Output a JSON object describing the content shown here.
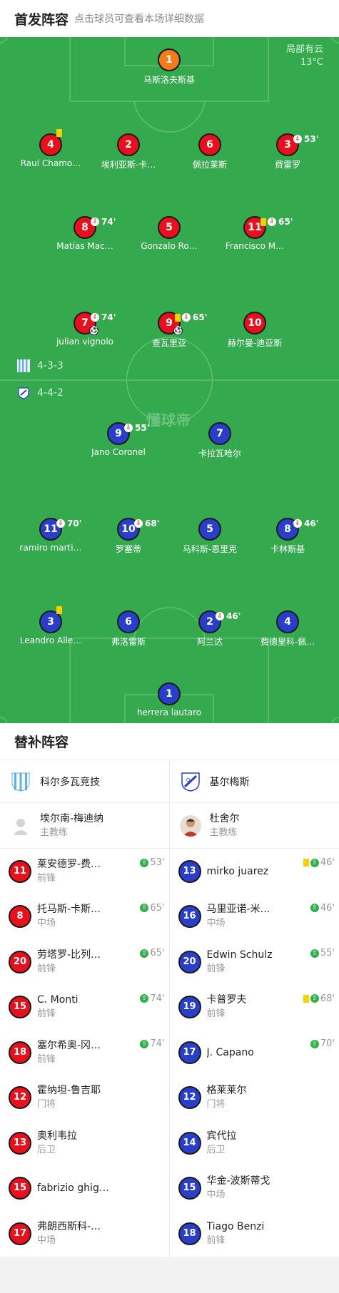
{
  "header": {
    "title": "首发阵容",
    "subtitle": "点击球员可查看本场详细数据"
  },
  "weather": {
    "condition": "局部有云",
    "temp": "13°C"
  },
  "watermark": "懂球帝",
  "formations": {
    "home": "4-3-3",
    "away": "4-4-2"
  },
  "home_players": [
    {
      "num": "1",
      "name": "马斯洛夫斯基",
      "color": "orange",
      "events": []
    },
    {
      "num": "4",
      "name": "Raul Chamo…",
      "color": "red",
      "yellow": true,
      "events": []
    },
    {
      "num": "2",
      "name": "埃利亚斯-卡…",
      "color": "red",
      "events": []
    },
    {
      "num": "6",
      "name": "佩拉莱斯",
      "color": "red",
      "events": []
    },
    {
      "num": "3",
      "name": "费雷罗",
      "color": "red",
      "sub_out": true,
      "sub_time": "53'"
    },
    {
      "num": "8",
      "name": "Matías Mac…",
      "color": "red",
      "sub_out": true,
      "sub_time": "74'"
    },
    {
      "num": "5",
      "name": "Gonzalo Ro…",
      "color": "red"
    },
    {
      "num": "11",
      "name": "Francisco M…",
      "color": "red",
      "yellow": true,
      "sub_out": true,
      "sub_time": "65'"
    },
    {
      "num": "7",
      "name": "julian vignolo",
      "color": "red",
      "sub_out": true,
      "sub_time": "74'",
      "goal": true
    },
    {
      "num": "9",
      "name": "查瓦里亚",
      "color": "red",
      "yellow": true,
      "sub_out": true,
      "sub_time": "65'",
      "goal": true
    },
    {
      "num": "10",
      "name": "赫尔曼-迪亚斯",
      "color": "red"
    }
  ],
  "away_players": [
    {
      "num": "9",
      "name": "Jano Coronel",
      "color": "blue",
      "sub_out": true,
      "sub_time": "55'"
    },
    {
      "num": "7",
      "name": "卡拉瓦哈尔",
      "color": "blue"
    },
    {
      "num": "11",
      "name": "ramiro marti…",
      "color": "blue",
      "sub_out": true,
      "sub_time": "70'"
    },
    {
      "num": "10",
      "name": "罗塞蒂",
      "color": "blue",
      "sub_out": true,
      "sub_time": "68'"
    },
    {
      "num": "5",
      "name": "马科斯-恩里克",
      "color": "blue"
    },
    {
      "num": "8",
      "name": "卡林斯基",
      "color": "blue",
      "sub_out": true,
      "sub_time": "46'"
    },
    {
      "num": "3",
      "name": "Leandro Alle…",
      "color": "blue",
      "yellow": true
    },
    {
      "num": "6",
      "name": "弗洛雷斯",
      "color": "blue"
    },
    {
      "num": "2",
      "name": "阿兰达",
      "color": "blue",
      "sub_out": true,
      "sub_time": "46'"
    },
    {
      "num": "4",
      "name": "费德里科-佩…",
      "color": "blue"
    },
    {
      "num": "1",
      "name": "herrera lautaro",
      "color": "blue"
    }
  ],
  "subs_title": "替补阵容",
  "home_team": {
    "name": "科尔多瓦竞技",
    "coach": {
      "name": "埃尔南-梅迪纳",
      "role": "主教练"
    },
    "subs": [
      {
        "num": "11",
        "name": "莱安德罗-费…",
        "pos": "前锋",
        "time": "53'"
      },
      {
        "num": "8",
        "name": "托马斯-卡斯…",
        "pos": "中场",
        "time": "65'"
      },
      {
        "num": "20",
        "name": "劳塔罗-比列…",
        "pos": "前锋",
        "time": "65'"
      },
      {
        "num": "15",
        "name": "C. Monti",
        "pos": "前锋",
        "time": "74'"
      },
      {
        "num": "18",
        "name": "塞尔希奥-冈…",
        "pos": "前锋",
        "time": "74'"
      },
      {
        "num": "12",
        "name": "霍纳坦-鲁吉耶",
        "pos": "门将",
        "time": ""
      },
      {
        "num": "13",
        "name": "奥利韦拉",
        "pos": "后卫",
        "time": ""
      },
      {
        "num": "15",
        "name": "fabrizio ghiggia",
        "pos": "",
        "time": ""
      },
      {
        "num": "17",
        "name": "弗朗西斯科-…",
        "pos": "中场",
        "time": ""
      }
    ]
  },
  "away_team": {
    "name": "基尔梅斯",
    "coach": {
      "name": "杜舍尔",
      "role": "主教练"
    },
    "subs": [
      {
        "num": "13",
        "name": "mirko juarez",
        "pos": "",
        "time": "46'",
        "yellow": true
      },
      {
        "num": "16",
        "name": "马里亚诺-米…",
        "pos": "中场",
        "time": "46'"
      },
      {
        "num": "20",
        "name": "Edwin Schulz",
        "pos": "前锋",
        "time": "55'"
      },
      {
        "num": "19",
        "name": "卡普罗夫",
        "pos": "前锋",
        "time": "68'",
        "yellow": true
      },
      {
        "num": "17",
        "name": "J. Capano",
        "pos": "",
        "time": "70'"
      },
      {
        "num": "12",
        "name": "格莱莱尔",
        "pos": "门将",
        "time": ""
      },
      {
        "num": "14",
        "name": "宾代拉",
        "pos": "后卫",
        "time": ""
      },
      {
        "num": "15",
        "name": "华金-波斯蒂戈",
        "pos": "中场",
        "time": ""
      },
      {
        "num": "18",
        "name": "Tiago Benzi",
        "pos": "前锋",
        "time": ""
      }
    ]
  }
}
